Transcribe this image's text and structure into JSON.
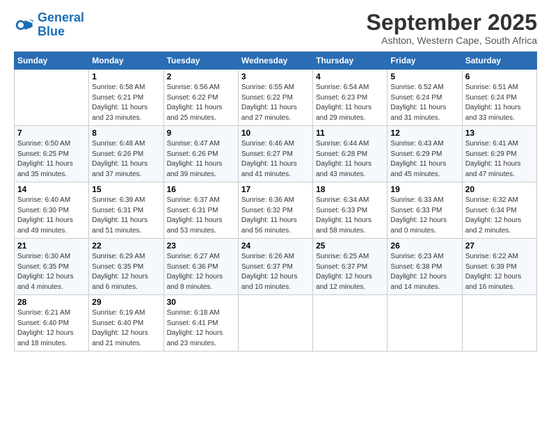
{
  "logo": {
    "line1": "General",
    "line2": "Blue"
  },
  "title": "September 2025",
  "subtitle": "Ashton, Western Cape, South Africa",
  "weekdays": [
    "Sunday",
    "Monday",
    "Tuesday",
    "Wednesday",
    "Thursday",
    "Friday",
    "Saturday"
  ],
  "weeks": [
    [
      {
        "day": "",
        "sunrise": "",
        "sunset": "",
        "daylight": ""
      },
      {
        "day": "1",
        "sunrise": "6:58 AM",
        "sunset": "6:21 PM",
        "daylight": "11 hours and 23 minutes."
      },
      {
        "day": "2",
        "sunrise": "6:56 AM",
        "sunset": "6:22 PM",
        "daylight": "11 hours and 25 minutes."
      },
      {
        "day": "3",
        "sunrise": "6:55 AM",
        "sunset": "6:22 PM",
        "daylight": "11 hours and 27 minutes."
      },
      {
        "day": "4",
        "sunrise": "6:54 AM",
        "sunset": "6:23 PM",
        "daylight": "11 hours and 29 minutes."
      },
      {
        "day": "5",
        "sunrise": "6:52 AM",
        "sunset": "6:24 PM",
        "daylight": "11 hours and 31 minutes."
      },
      {
        "day": "6",
        "sunrise": "6:51 AM",
        "sunset": "6:24 PM",
        "daylight": "11 hours and 33 minutes."
      }
    ],
    [
      {
        "day": "7",
        "sunrise": "6:50 AM",
        "sunset": "6:25 PM",
        "daylight": "11 hours and 35 minutes."
      },
      {
        "day": "8",
        "sunrise": "6:48 AM",
        "sunset": "6:26 PM",
        "daylight": "11 hours and 37 minutes."
      },
      {
        "day": "9",
        "sunrise": "6:47 AM",
        "sunset": "6:26 PM",
        "daylight": "11 hours and 39 minutes."
      },
      {
        "day": "10",
        "sunrise": "6:46 AM",
        "sunset": "6:27 PM",
        "daylight": "11 hours and 41 minutes."
      },
      {
        "day": "11",
        "sunrise": "6:44 AM",
        "sunset": "6:28 PM",
        "daylight": "11 hours and 43 minutes."
      },
      {
        "day": "12",
        "sunrise": "6:43 AM",
        "sunset": "6:29 PM",
        "daylight": "11 hours and 45 minutes."
      },
      {
        "day": "13",
        "sunrise": "6:41 AM",
        "sunset": "6:29 PM",
        "daylight": "11 hours and 47 minutes."
      }
    ],
    [
      {
        "day": "14",
        "sunrise": "6:40 AM",
        "sunset": "6:30 PM",
        "daylight": "11 hours and 49 minutes."
      },
      {
        "day": "15",
        "sunrise": "6:39 AM",
        "sunset": "6:31 PM",
        "daylight": "11 hours and 51 minutes."
      },
      {
        "day": "16",
        "sunrise": "6:37 AM",
        "sunset": "6:31 PM",
        "daylight": "11 hours and 53 minutes."
      },
      {
        "day": "17",
        "sunrise": "6:36 AM",
        "sunset": "6:32 PM",
        "daylight": "11 hours and 56 minutes."
      },
      {
        "day": "18",
        "sunrise": "6:34 AM",
        "sunset": "6:33 PM",
        "daylight": "11 hours and 58 minutes."
      },
      {
        "day": "19",
        "sunrise": "6:33 AM",
        "sunset": "6:33 PM",
        "daylight": "12 hours and 0 minutes."
      },
      {
        "day": "20",
        "sunrise": "6:32 AM",
        "sunset": "6:34 PM",
        "daylight": "12 hours and 2 minutes."
      }
    ],
    [
      {
        "day": "21",
        "sunrise": "6:30 AM",
        "sunset": "6:35 PM",
        "daylight": "12 hours and 4 minutes."
      },
      {
        "day": "22",
        "sunrise": "6:29 AM",
        "sunset": "6:35 PM",
        "daylight": "12 hours and 6 minutes."
      },
      {
        "day": "23",
        "sunrise": "6:27 AM",
        "sunset": "6:36 PM",
        "daylight": "12 hours and 8 minutes."
      },
      {
        "day": "24",
        "sunrise": "6:26 AM",
        "sunset": "6:37 PM",
        "daylight": "12 hours and 10 minutes."
      },
      {
        "day": "25",
        "sunrise": "6:25 AM",
        "sunset": "6:37 PM",
        "daylight": "12 hours and 12 minutes."
      },
      {
        "day": "26",
        "sunrise": "6:23 AM",
        "sunset": "6:38 PM",
        "daylight": "12 hours and 14 minutes."
      },
      {
        "day": "27",
        "sunrise": "6:22 AM",
        "sunset": "6:39 PM",
        "daylight": "12 hours and 16 minutes."
      }
    ],
    [
      {
        "day": "28",
        "sunrise": "6:21 AM",
        "sunset": "6:40 PM",
        "daylight": "12 hours and 18 minutes."
      },
      {
        "day": "29",
        "sunrise": "6:19 AM",
        "sunset": "6:40 PM",
        "daylight": "12 hours and 21 minutes."
      },
      {
        "day": "30",
        "sunrise": "6:18 AM",
        "sunset": "6:41 PM",
        "daylight": "12 hours and 23 minutes."
      },
      {
        "day": "",
        "sunrise": "",
        "sunset": "",
        "daylight": ""
      },
      {
        "day": "",
        "sunrise": "",
        "sunset": "",
        "daylight": ""
      },
      {
        "day": "",
        "sunrise": "",
        "sunset": "",
        "daylight": ""
      },
      {
        "day": "",
        "sunrise": "",
        "sunset": "",
        "daylight": ""
      }
    ]
  ]
}
